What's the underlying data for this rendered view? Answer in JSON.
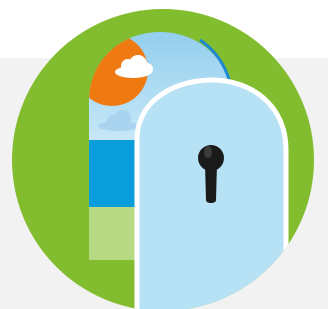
{
  "colors": {
    "page_background": "#ffffff",
    "band_background": "#f2f2f2",
    "circle_green": "#82bd2f",
    "sky_light": "#bfe3f6",
    "sky_top": "#8fcdee",
    "sun_orange": "#f07a12",
    "sea_blue": "#0a9ddc",
    "field_green": "#b7d983",
    "door_fill": "#b7e1f5",
    "door_outline": "#ffffff",
    "arch_outline": "#1e88d0",
    "keyhole": "#1a1a1a",
    "cloud_white": "#ffffff",
    "cloud_faint": "#a9d3ef"
  },
  "icons": {
    "main": "open-door-keyhole-icon",
    "scene": "landscape-through-doorway-icon"
  }
}
